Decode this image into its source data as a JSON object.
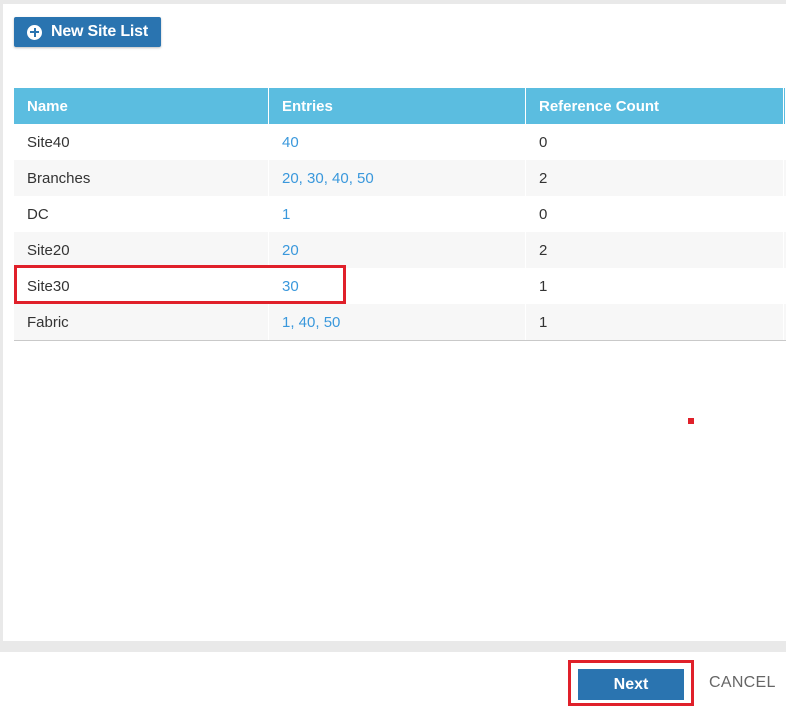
{
  "toolbar": {
    "new_button_label": "New Site List",
    "new_button_icon": "plus-circle-icon"
  },
  "table": {
    "headers": [
      "Name",
      "Entries",
      "Reference Count"
    ],
    "rows": [
      {
        "name": "Site40",
        "entries": "40",
        "refcount": "0"
      },
      {
        "name": "Branches",
        "entries": "20, 30, 40, 50",
        "refcount": "2"
      },
      {
        "name": "DC",
        "entries": "1",
        "refcount": "0"
      },
      {
        "name": "Site20",
        "entries": "20",
        "refcount": "2"
      },
      {
        "name": "Site30",
        "entries": "30",
        "refcount": "1"
      },
      {
        "name": "Fabric",
        "entries": "1, 40, 50",
        "refcount": "1"
      }
    ]
  },
  "footer": {
    "next_label": "Next",
    "cancel_label": "CANCEL"
  },
  "colors": {
    "header_bg": "#5bbde0",
    "button_bg": "#2a74b0",
    "link": "#3a98dc",
    "highlight": "#e0202a"
  }
}
